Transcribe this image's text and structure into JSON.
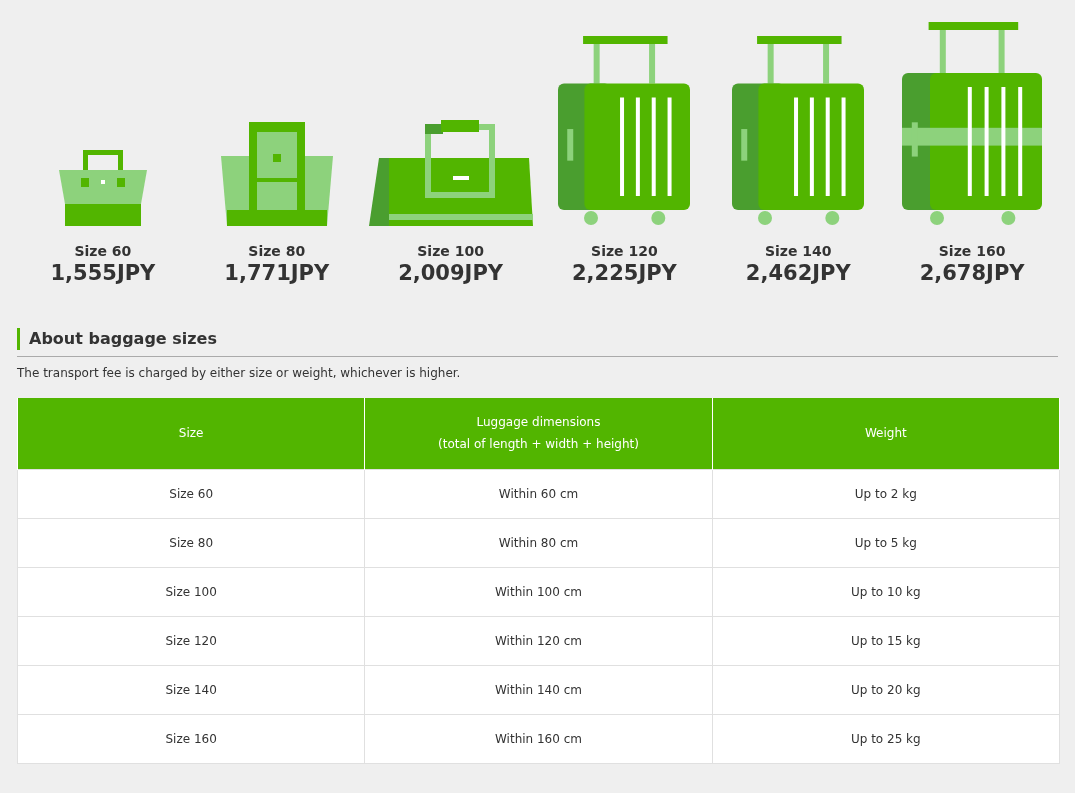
{
  "sizes": [
    {
      "kind": "handbag",
      "label": "Size 60",
      "price": "1,555JPY"
    },
    {
      "kind": "tote",
      "label": "Size 80",
      "price": "1,771JPY"
    },
    {
      "kind": "duffel",
      "label": "Size 100",
      "price": "2,009JPY"
    },
    {
      "kind": "suitcase",
      "label": "Size 120",
      "price": "2,225JPY"
    },
    {
      "kind": "suitcase",
      "label": "Size 140",
      "price": "2,462JPY"
    },
    {
      "kind": "suitcase-strap",
      "label": "Size 160",
      "price": "2,678JPY"
    }
  ],
  "section": {
    "title": "About baggage sizes",
    "note": "The transport fee is charged by either size or weight, whichever is higher."
  },
  "table": {
    "columns": [
      "Size",
      "Luggage dimensions\n(total of length + width + height)",
      "Weight"
    ],
    "rows": [
      [
        "Size 60",
        "Within 60 cm",
        "Up to 2 kg"
      ],
      [
        "Size 80",
        "Within 80 cm",
        "Up to 5 kg"
      ],
      [
        "Size 100",
        "Within 100 cm",
        "Up to 10 kg"
      ],
      [
        "Size 120",
        "Within 120 cm",
        "Up to 15 kg"
      ],
      [
        "Size 140",
        "Within 140 cm",
        "Up to 20 kg"
      ],
      [
        "Size 160",
        "Within 160 cm",
        "Up to 25 kg"
      ]
    ]
  }
}
